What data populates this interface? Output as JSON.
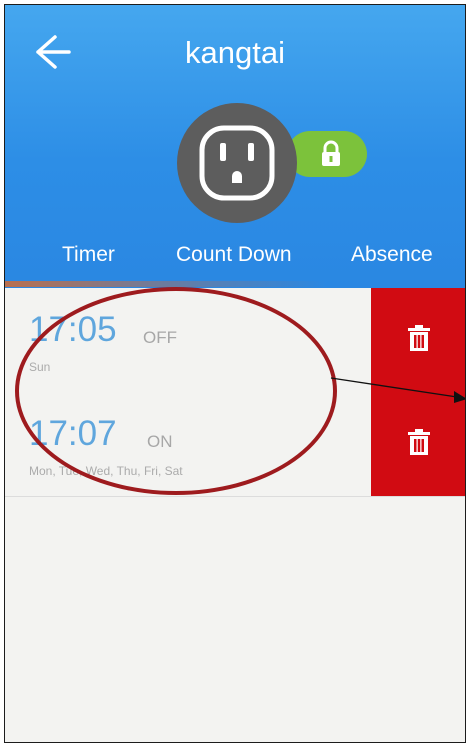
{
  "app": {
    "title": "kangtai"
  },
  "icons": {
    "back": "arrow-left-icon",
    "socket": "power-socket-icon",
    "lock": "lock-icon",
    "delete": "trash-icon"
  },
  "colors": {
    "header_blue": "#2d8ee6",
    "delete_red": "#d10b12",
    "lock_green": "#7cc23b",
    "time_blue": "#5fa6dd",
    "annotation_red": "#9e1b1e"
  },
  "tabs": [
    {
      "label": "Timer"
    },
    {
      "label": "Count Down"
    },
    {
      "label": "Absence"
    }
  ],
  "timers": [
    {
      "time": "17:05",
      "state": "OFF",
      "days": "Sun"
    },
    {
      "time": "17:07",
      "state": "ON",
      "days": "Mon, Tue, Wed, Thu, Fri, Sat"
    }
  ]
}
